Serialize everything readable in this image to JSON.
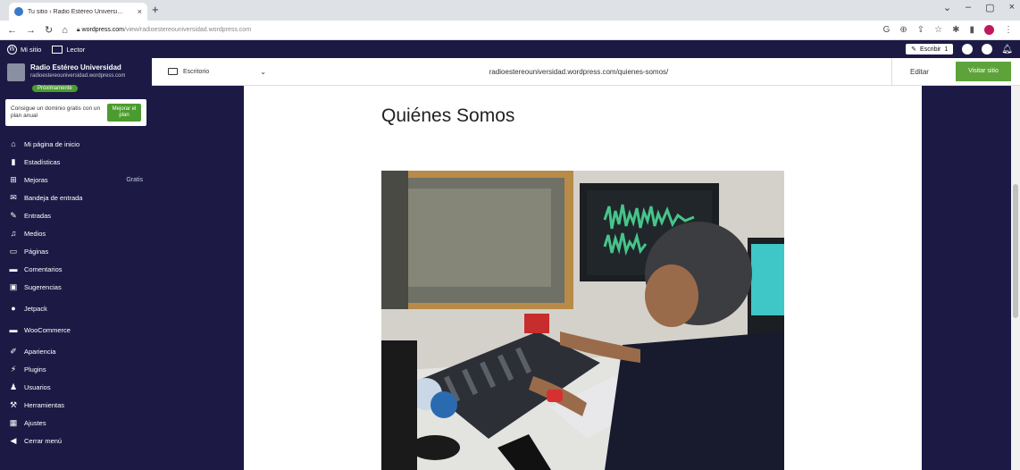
{
  "browser": {
    "tab_title": "Tu sitio ‹ Radio Estéreo Universi…",
    "tab_close": "×",
    "new_tab": "+",
    "url_domain": "wordpress.com",
    "url_path": "/view/radioestereouniversidad.wordpress.com",
    "window_controls": [
      "⌄",
      "–",
      "▢",
      "×"
    ]
  },
  "adminbar": {
    "my_site": "Mi sitio",
    "reader": "Lector",
    "write": "Escribir",
    "write_count": "1"
  },
  "sidebar": {
    "site_name": "Radio Estéreo Universidad",
    "site_url": "radioestereouniversidad.wordpress.com",
    "site_badge": "Próximamente",
    "promo_text": "Consigue un dominio gratis con un plan anual",
    "promo_button": "Mejorar el plan",
    "items": [
      {
        "label": "Mi página de inicio",
        "icon": "home-icon"
      },
      {
        "label": "Estadísticas",
        "icon": "stats-icon"
      },
      {
        "label": "Mejoras",
        "icon": "cart-icon",
        "extra": "Gratis"
      },
      {
        "label": "Bandeja de entrada",
        "icon": "inbox-icon"
      },
      {
        "label": "Entradas",
        "icon": "pin-icon"
      },
      {
        "label": "Medios",
        "icon": "media-icon"
      },
      {
        "label": "Páginas",
        "icon": "pages-icon"
      },
      {
        "label": "Comentarios",
        "icon": "comments-icon"
      },
      {
        "label": "Sugerencias",
        "icon": "feedback-icon"
      },
      {
        "label": "Jetpack",
        "icon": "jetpack-icon"
      },
      {
        "label": "WooCommerce",
        "icon": "woocommerce-icon"
      },
      {
        "label": "Apariencia",
        "icon": "brush-icon"
      },
      {
        "label": "Plugins",
        "icon": "plugin-icon"
      },
      {
        "label": "Usuarios",
        "icon": "users-icon"
      },
      {
        "label": "Herramientas",
        "icon": "tools-icon"
      },
      {
        "label": "Ajustes",
        "icon": "settings-icon"
      },
      {
        "label": "Cerrar menú",
        "icon": "collapse-icon"
      }
    ]
  },
  "preview": {
    "device": "Escritorio",
    "url": "radioestereouniversidad.wordpress.com/quienes-somos/",
    "edit": "Editar",
    "visit": "Visitar sitio"
  },
  "page": {
    "title": "Quiénes Somos"
  },
  "colors": {
    "admin_bg": "#1c1a45",
    "accent_green": "#5da33a"
  }
}
